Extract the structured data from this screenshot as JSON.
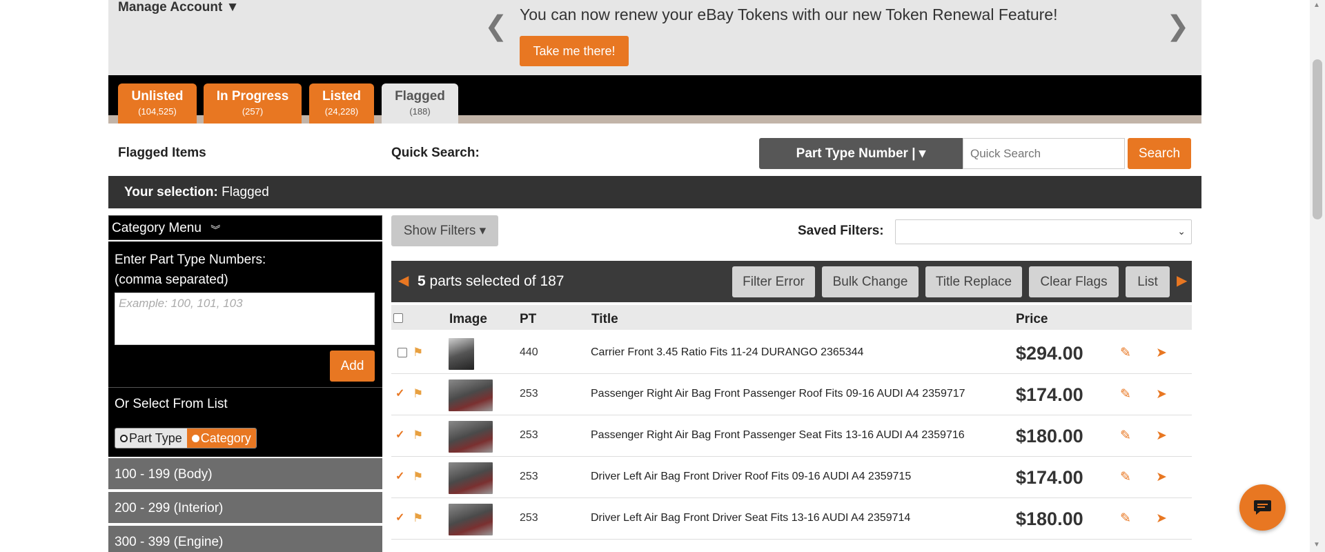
{
  "banner": {
    "manage_account": "Manage Account ▼",
    "message": "You can now renew your eBay Tokens with our new Token Renewal Feature!",
    "cta": "Take me there!"
  },
  "tabs": [
    {
      "label": "Unlisted",
      "count": "(104,525)"
    },
    {
      "label": "In Progress",
      "count": "(257)"
    },
    {
      "label": "Listed",
      "count": "(24,228)"
    },
    {
      "label": "Flagged",
      "count": "(188)"
    }
  ],
  "toolbar": {
    "heading": "Flagged Items",
    "quick_search_label": "Quick Search:",
    "search_type": "Part Type Number | ▾",
    "search_placeholder": "Quick Search",
    "search_button": "Search"
  },
  "selection": {
    "label": "Your selection:",
    "value": "Flagged"
  },
  "sidebar": {
    "category_menu": "Category Menu",
    "enter_label_1": "Enter Part Type Numbers:",
    "enter_label_2": "(comma separated)",
    "textarea_placeholder": "Example: 100, 101, 103",
    "add_button": "Add",
    "or_select": "Or Select From List",
    "toggle_part_type": "Part Type",
    "toggle_category": "Category",
    "ranges": [
      "100 - 199 (Body)",
      "200 - 299 (Interior)",
      "300 - 399 (Engine)"
    ]
  },
  "filters": {
    "show_filters": "Show Filters ▾",
    "saved_filters_label": "Saved Filters:"
  },
  "actions": {
    "count_number": "5",
    "count_text": "parts selected of 187",
    "filter_error": "Filter Error",
    "bulk_change": "Bulk Change",
    "title_replace": "Title Replace",
    "clear_flags": "Clear Flags",
    "list": "List"
  },
  "table": {
    "headers": {
      "image": "Image",
      "pt": "PT",
      "title": "Title",
      "price": "Price"
    },
    "rows": [
      {
        "pt": "440",
        "title": "Carrier Front 3.45 Ratio Fits 11-24 DURANGO 2365344",
        "price": "$294.00"
      },
      {
        "pt": "253",
        "title": "Passenger Right Air Bag Front Passenger Roof Fits 09-16 AUDI A4 2359717",
        "price": "$174.00"
      },
      {
        "pt": "253",
        "title": "Passenger Right Air Bag Front Passenger Seat Fits 13-16 AUDI A4 2359716",
        "price": "$180.00"
      },
      {
        "pt": "253",
        "title": "Driver Left Air Bag Front Driver Roof Fits 09-16 AUDI A4 2359715",
        "price": "$174.00"
      },
      {
        "pt": "253",
        "title": "Driver Left Air Bag Front Driver Seat Fits 13-16 AUDI A4 2359714",
        "price": "$180.00"
      }
    ]
  },
  "colors": {
    "accent": "#e87722",
    "dark": "#333333"
  }
}
